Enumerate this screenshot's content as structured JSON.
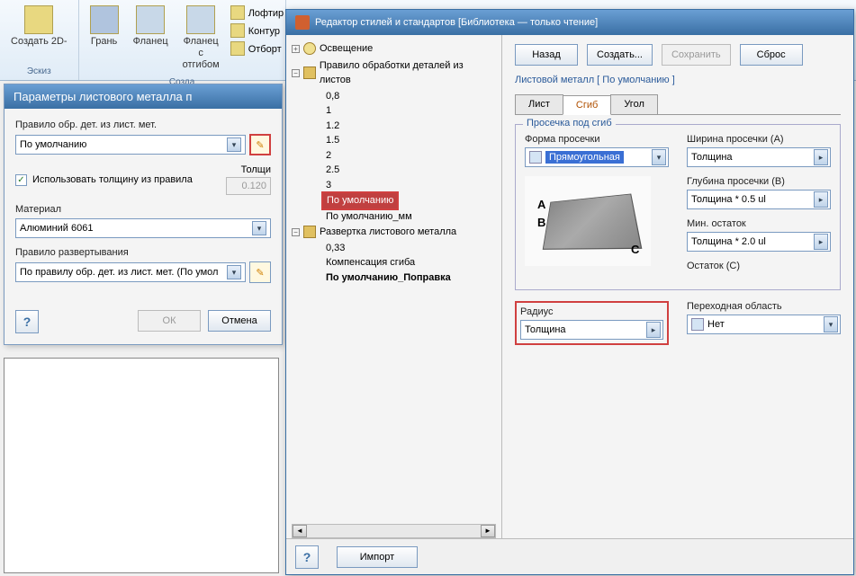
{
  "ribbon": {
    "create2d": "Создать\n2D-",
    "face": "Грань",
    "flange": "Фланец",
    "flange_bend": "Фланец с\nотгибом",
    "loft": "Лофтир",
    "contour": "Контур",
    "cutoff": "Отборт",
    "group_sketch": "Эскиз",
    "group_create": "Созда"
  },
  "leftDialog": {
    "title": "Параметры листового металла п",
    "ruleLabel": "Правило обр. дет. из лист. мет.",
    "ruleValue": "По умолчанию",
    "useThickness": "Использовать толщину из правила",
    "thicknessLabel": "Толщи",
    "thicknessValue": "0.120",
    "materialLabel": "Материал",
    "materialValue": "Алюминий 6061",
    "unfoldRuleLabel": "Правило развертывания",
    "unfoldRuleValue": "По правилу обр. дет. из лист. мет. (По умол",
    "ok": "ОК",
    "cancel": "Отмена"
  },
  "rightDialog": {
    "title": "Редактор стилей и стандартов [Библиотека — только чтение]",
    "back": "Назад",
    "create": "Создать...",
    "save": "Сохранить",
    "reset": "Сброс",
    "breadcrumb": "Листовой металл [ По умолчанию ]",
    "tabs": {
      "sheet": "Лист",
      "bend": "Сгиб",
      "corner": "Угол"
    },
    "tree": {
      "lighting": "Освещение",
      "ruleLabel": "Правило обработки деталей из листов",
      "leaves": [
        "0,8",
        "1",
        "1.2",
        "1.5",
        "2",
        "2.5",
        "3"
      ],
      "default": "По умолчанию",
      "defaultMm": "По умолчанию_мм",
      "unfold": "Развертка листового металла",
      "v033": "0,33",
      "bendComp": "Компенсация сгиба",
      "defaultCorr": "По умолчанию_Поправка"
    },
    "relief": {
      "legend": "Просечка под сгиб",
      "shapeLabel": "Форма просечки",
      "shapeValue": "Прямоугольная",
      "widthLabel": "Ширина просечки (A)",
      "widthValue": "Толщина",
      "depthLabel": "Глубина просечки (B)",
      "depthValue": "Толщина * 0.5 ul",
      "minRemLabel": "Мин. остаток",
      "minRemValue": "Толщина * 2.0 ul",
      "remLabel": "Остаток (C)"
    },
    "radius": {
      "label": "Радиус",
      "value": "Толщина"
    },
    "transition": {
      "label": "Переходная область",
      "value": "Нет"
    },
    "import": "Импорт",
    "previewLabels": {
      "a": "A",
      "b": "B",
      "c": "C"
    }
  }
}
